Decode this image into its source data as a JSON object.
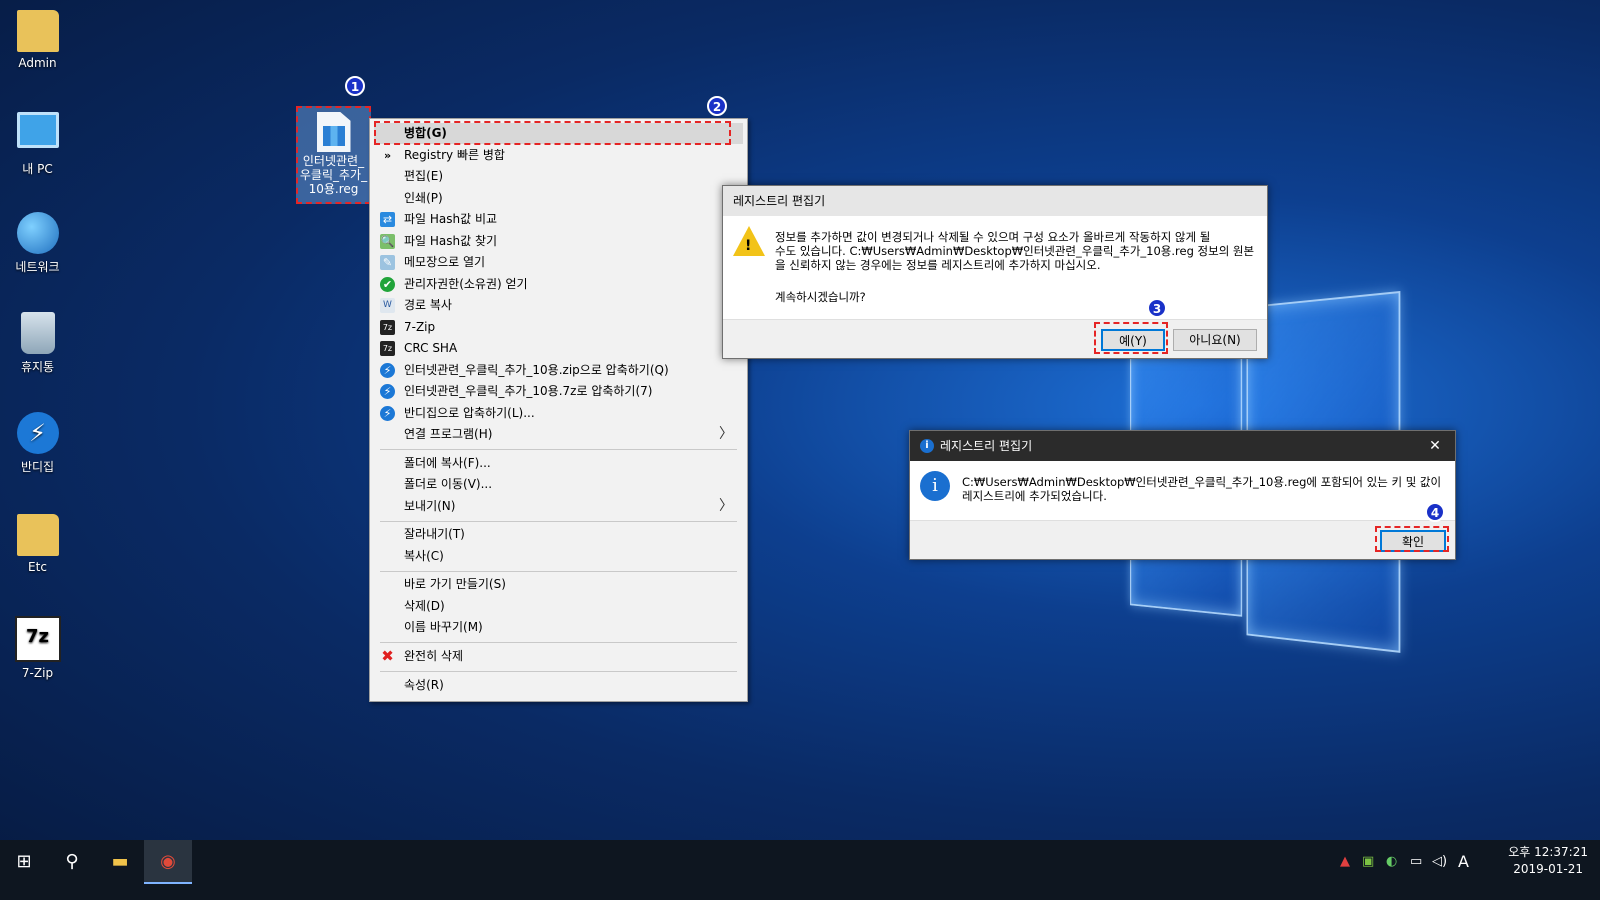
{
  "desktop": {
    "icons": [
      {
        "label": "Admin",
        "icon": "user-folder-icon"
      },
      {
        "label": "내 PC",
        "icon": "computer-icon"
      },
      {
        "label": "네트워크",
        "icon": "network-icon"
      },
      {
        "label": "휴지통",
        "icon": "recycle-bin-icon"
      },
      {
        "label": "반디집",
        "icon": "bandizip-icon"
      },
      {
        "label": "Etc",
        "icon": "folder-icon"
      },
      {
        "label": "7-Zip",
        "icon": "7zip-icon"
      }
    ],
    "selected_file": {
      "line1": "인터넷관련_",
      "line2": "우클릭_추가_",
      "line3": "10용.reg"
    }
  },
  "badges": [
    "1",
    "2",
    "3",
    "4"
  ],
  "context_menu": {
    "items": [
      {
        "label": "병합(G)",
        "icon": ""
      },
      {
        "label": "Registry 빠른 병합",
        "icon": "»"
      },
      {
        "label": "편집(E)",
        "icon": ""
      },
      {
        "label": "인쇄(P)",
        "icon": ""
      },
      {
        "label": "파일 Hash값 비교",
        "icon": "⇄"
      },
      {
        "label": "파일 Hash값 찾기",
        "icon": "🔍"
      },
      {
        "label": "메모장으로 열기",
        "icon": "✎"
      },
      {
        "label": "관리자권한(소유권) 얻기",
        "icon": "✔"
      },
      {
        "label": "경로 복사",
        "icon": "W"
      },
      {
        "label": "7-Zip",
        "icon": "7z"
      },
      {
        "label": "CRC SHA",
        "icon": "7z"
      },
      {
        "label": "인터넷관련_우클릭_추가_10용.zip으로 압축하기(Q)",
        "icon": "⚡"
      },
      {
        "label": "인터넷관련_우클릭_추가_10용.7z로 압축하기(7)",
        "icon": "⚡"
      },
      {
        "label": "반디집으로 압축하기(L)...",
        "icon": "⚡"
      },
      {
        "label": "연결 프로그램(H)",
        "icon": ""
      },
      {
        "label": "폴더에 복사(F)...",
        "icon": ""
      },
      {
        "label": "폴더로 이동(V)...",
        "icon": ""
      },
      {
        "label": "보내기(N)",
        "icon": ""
      },
      {
        "label": "잘라내기(T)",
        "icon": ""
      },
      {
        "label": "복사(C)",
        "icon": ""
      },
      {
        "label": "바로 가기 만들기(S)",
        "icon": ""
      },
      {
        "label": "삭제(D)",
        "icon": ""
      },
      {
        "label": "이름 바꾸기(M)",
        "icon": ""
      },
      {
        "label": "완전히 삭제",
        "icon": "✖"
      },
      {
        "label": "속성(R)",
        "icon": ""
      }
    ],
    "submenu_arrow": "〉"
  },
  "dialog_warning": {
    "title": "레지스트리 편집기",
    "message_line1": "정보를 추가하면 값이 변경되거나 삭제될 수 있으며 구성 요소가 올바르게 작동하지 않게 될",
    "message_line2": "수도 있습니다. C:₩Users₩Admin₩Desktop₩인터넷관련_우클릭_추가_10용.reg 정보의 원본",
    "message_line3": "을 신뢰하지 않는 경우에는 정보를 레지스트리에 추가하지 마십시오.",
    "question": "계속하시겠습니까?",
    "yes": "예(Y)",
    "no": "아니요(N)",
    "icon": "!"
  },
  "dialog_info": {
    "title": "레지스트리 편집기",
    "message_line1": "C:₩Users₩Admin₩Desktop₩인터넷관련_우클릭_추가_10용.reg에 포함되어 있는 키 및 값이",
    "message_line2": "레지스트리에 추가되었습니다.",
    "ok": "확인",
    "close": "✕",
    "icon": "i"
  },
  "taskbar": {
    "start": "⊞",
    "search": "⚲",
    "explorer": "▬",
    "browser": "◉",
    "tray_ime": "A",
    "time": "오후 12:37:21",
    "date": "2019-01-21"
  }
}
